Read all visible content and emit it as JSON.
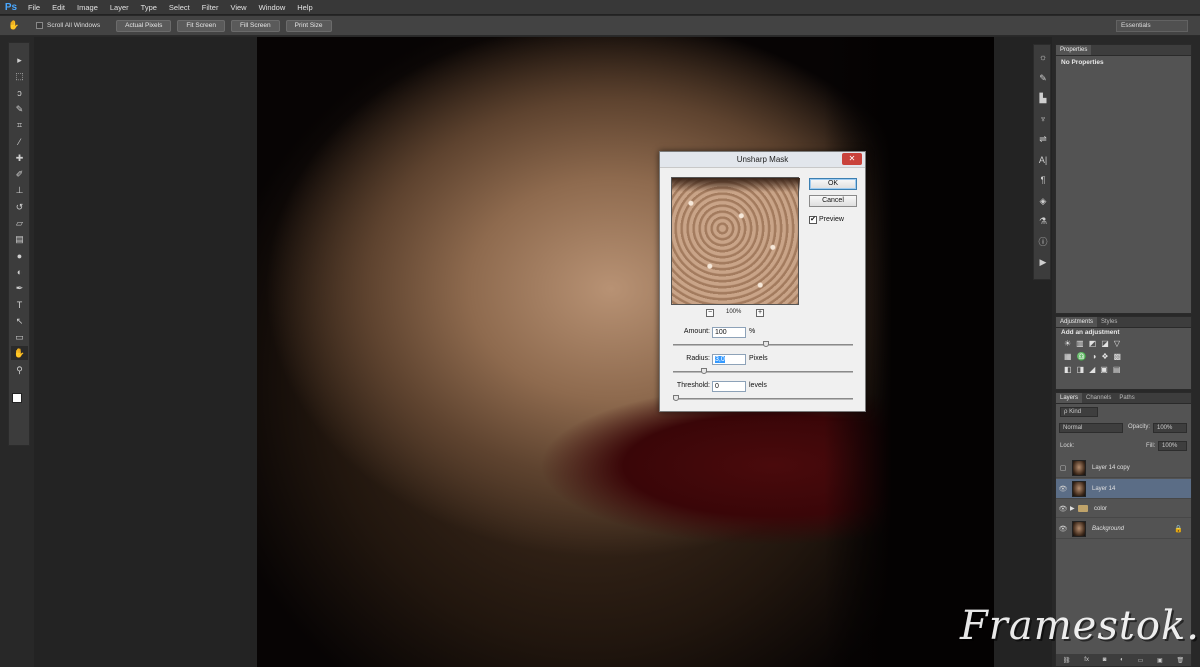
{
  "app": {
    "logo": "Ps",
    "accent": "#4aa8ff"
  },
  "menu": [
    "File",
    "Edit",
    "Image",
    "Layer",
    "Type",
    "Select",
    "Filter",
    "View",
    "Window",
    "Help"
  ],
  "options_bar": {
    "scroll_all_windows": "Scroll All Windows",
    "buttons": [
      "Actual Pixels",
      "Fit Screen",
      "Fill Screen",
      "Print Size"
    ],
    "workspace": "Essentials"
  },
  "tools": [
    {
      "name": "move-tool",
      "glyph": "▸"
    },
    {
      "name": "marquee-tool",
      "glyph": "⬚"
    },
    {
      "name": "lasso-tool",
      "glyph": "ↄ"
    },
    {
      "name": "quick-select-tool",
      "glyph": "✎"
    },
    {
      "name": "crop-tool",
      "glyph": "⌗"
    },
    {
      "name": "eyedropper-tool",
      "glyph": "⁄"
    },
    {
      "name": "healing-brush-tool",
      "glyph": "✚"
    },
    {
      "name": "brush-tool",
      "glyph": "✐"
    },
    {
      "name": "clone-stamp-tool",
      "glyph": "⊥"
    },
    {
      "name": "history-brush-tool",
      "glyph": "↺"
    },
    {
      "name": "eraser-tool",
      "glyph": "▱"
    },
    {
      "name": "gradient-tool",
      "glyph": "▤"
    },
    {
      "name": "blur-tool",
      "glyph": "●"
    },
    {
      "name": "dodge-tool",
      "glyph": "◐"
    },
    {
      "name": "pen-tool",
      "glyph": "✒"
    },
    {
      "name": "type-tool",
      "glyph": "T"
    },
    {
      "name": "path-select-tool",
      "glyph": "↖"
    },
    {
      "name": "shape-tool",
      "glyph": "▭"
    },
    {
      "name": "hand-tool",
      "glyph": "✋"
    },
    {
      "name": "zoom-tool",
      "glyph": "⚲"
    }
  ],
  "dialog": {
    "title": "Unsharp Mask",
    "close": "✕",
    "ok": "OK",
    "cancel": "Cancel",
    "preview_label": "Preview",
    "preview_checked": true,
    "check_mark": "✔",
    "zoom": "100%",
    "zoom_minus": "−",
    "zoom_plus": "+",
    "amount": {
      "label": "Amount:",
      "value": "100",
      "unit": "%",
      "slider": 0.52
    },
    "radius": {
      "label": "Radius:",
      "value": "3,0",
      "unit": "Pixels",
      "slider": 0.16
    },
    "threshold": {
      "label": "Threshold:",
      "value": "0",
      "unit": "levels",
      "slider": 0.0
    }
  },
  "side_icons": [
    "☼",
    "✎",
    "▙",
    "♆",
    "⇌",
    "A|",
    "¶",
    "◈",
    "⚗",
    "ⓘ",
    "▶"
  ],
  "properties": {
    "tab": "Properties",
    "text": "No Properties"
  },
  "adjustments": {
    "tabs": [
      "Adjustments",
      "Styles"
    ],
    "title": "Add an adjustment",
    "rows": [
      [
        "☀",
        "▥",
        "◩",
        "◪",
        "▽"
      ],
      [
        "▦",
        "♎",
        "◑",
        "❖",
        "▩"
      ],
      [
        "◧",
        "◨",
        "◢",
        "▣",
        "▤"
      ]
    ]
  },
  "layers": {
    "tabs": [
      "Layers",
      "Channels",
      "Paths"
    ],
    "kind": "ρ Kind",
    "blend": "Normal",
    "opacity_label": "Opacity:",
    "opacity": "100%",
    "lock_label": "Lock:",
    "fill_label": "Fill:",
    "fill": "100%",
    "items": [
      {
        "name": "Layer 14 copy",
        "visible": false,
        "type": "image",
        "selected": false
      },
      {
        "name": "Layer 14",
        "visible": true,
        "type": "image",
        "selected": true
      },
      {
        "name": "color",
        "visible": true,
        "type": "group",
        "selected": false
      },
      {
        "name": "Background",
        "visible": true,
        "type": "image",
        "selected": false,
        "locked": true
      }
    ],
    "footer_icons": [
      "⛓",
      "fx",
      "◙",
      "◐",
      "▭",
      "▣",
      "🗑"
    ]
  },
  "watermark": "Framestok.ru"
}
